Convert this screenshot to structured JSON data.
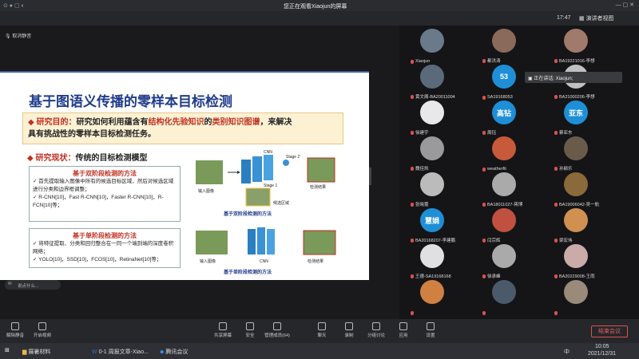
{
  "window": {
    "title": "您正在观看Xiaojun的屏幕",
    "time": "17:47",
    "speaker_view": "演讲者视图"
  },
  "share": {
    "unmute_hint": "取消静音"
  },
  "slide": {
    "title": "基于图语义传播的零样本目标检测",
    "purpose_label": "研究目的：",
    "purpose_text": "研究如何利用蕴含有",
    "purpose_hl1": "结构化先验知识",
    "purpose_mid": "的",
    "purpose_hl2": "类别知识图谱",
    "purpose_end": "，来解决",
    "purpose_line2": "具有挑战性的零样本目标检测任务。",
    "status_label": "研究现状：",
    "status_text": "传统的目标检测模型",
    "two_stage_title": "基于双阶段检测的方法",
    "two_stage_bullet1": "首先提取输入图像中所有的候选目标区域，然后对候选区域进行分类和边界框调整；",
    "two_stage_bullet2": "R-CNN[10]，Fast R-CNN[10]，Faster R-CNN[10]，R-FCN[10]等；",
    "one_stage_title": "基于单阶段检测的方法",
    "one_stage_bullet1": "将特征提取、分类和回归整合在一同一个端到端的深度卷积网络；",
    "one_stage_bullet2": "YOLO[10]，SSD[10]，FCOS[10]，RetinaNet[10]等；",
    "fig1_input": "输入图像",
    "fig1_output": "检测结果",
    "fig1_cnn": "CNN",
    "fig1_stage1": "Stage 1",
    "fig1_stage2": "Stage 2",
    "fig1_region": "候选区域",
    "fig1_caption": "基于双阶段检测的方法",
    "fig2_input": "输入图像",
    "fig2_cnn": "CNN",
    "fig2_output": "检测结果",
    "fig2_caption": "基于单阶段检测的方法"
  },
  "chat_hint": "说点什么...",
  "speaking": "正在讲话: Xiaojun;",
  "participants": [
    {
      "name": "Xiaojun",
      "color": "#6a7a8a",
      "initials": ""
    },
    {
      "name": "都洪涛",
      "color": "#8a6a5a",
      "initials": ""
    },
    {
      "name": "BA19221016-李想",
      "color": "#a07a6a",
      "initials": ""
    },
    {
      "name": "黄文阁-BA20011004",
      "color": "#5a6a7a",
      "initials": ""
    },
    {
      "name": "SA19168053",
      "color": "#1e8fd6",
      "initials": "53"
    },
    {
      "name": "BA21000206-李想",
      "color": "#c0c0c0",
      "initials": ""
    },
    {
      "name": "徐建宇",
      "color": "#e8e8e8",
      "initials": ""
    },
    {
      "name": "周钰",
      "color": "#1e8fd6",
      "initials": "高钻"
    },
    {
      "name": "蔡亚东",
      "color": "#1e8fd6",
      "initials": "亚东"
    },
    {
      "name": "魏佳凯",
      "color": "#9a9a9a",
      "initials": ""
    },
    {
      "name": "weatherfit",
      "color": "#c65a3a",
      "initials": ""
    },
    {
      "name": "孙颖乐",
      "color": "#6a5a4a",
      "initials": ""
    },
    {
      "name": "张晓蕾",
      "color": "#bbbbbb",
      "initials": ""
    },
    {
      "name": "BA18011027-蒋博",
      "color": "#aaaaaa",
      "initials": ""
    },
    {
      "name": "BA19006042-吴一航",
      "color": "#8a6a3a",
      "initials": ""
    },
    {
      "name": "BA20168207-李建鹏",
      "color": "#1e8fd6",
      "initials": "慧娟"
    },
    {
      "name": "闫宗辉",
      "color": "#c05040",
      "initials": ""
    },
    {
      "name": "梁宏伟",
      "color": "#d09050",
      "initials": ""
    },
    {
      "name": "王德-SA19168168",
      "color": "#e0e0e0",
      "initials": ""
    },
    {
      "name": "徐承峰",
      "color": "#aaaaaa",
      "initials": ""
    },
    {
      "name": "BA20229008-王雨",
      "color": "#ccaaaa",
      "initials": ""
    },
    {
      "name": "",
      "color": "#d08040",
      "initials": ""
    },
    {
      "name": "",
      "color": "#4a5a6a",
      "initials": ""
    },
    {
      "name": "",
      "color": "#9a8a7a",
      "initials": ""
    }
  ],
  "toolbar": {
    "mute": "解除静音",
    "video": "开启视频",
    "share": "共享屏幕",
    "security": "安全",
    "members": "成员(64)",
    "apps": "管理成员(64)",
    "chat": "聊天",
    "record": "录制",
    "breakout": "分组讨论",
    "apps2": "应用",
    "settings": "设置",
    "end": "结束会议"
  },
  "taskbar": {
    "app1": "展暑材料",
    "app2": "0-1 周报文章-Xiao...",
    "app3": "腾讯会议",
    "time": "10:05",
    "date": "2021/12/31",
    "lang": "中"
  }
}
